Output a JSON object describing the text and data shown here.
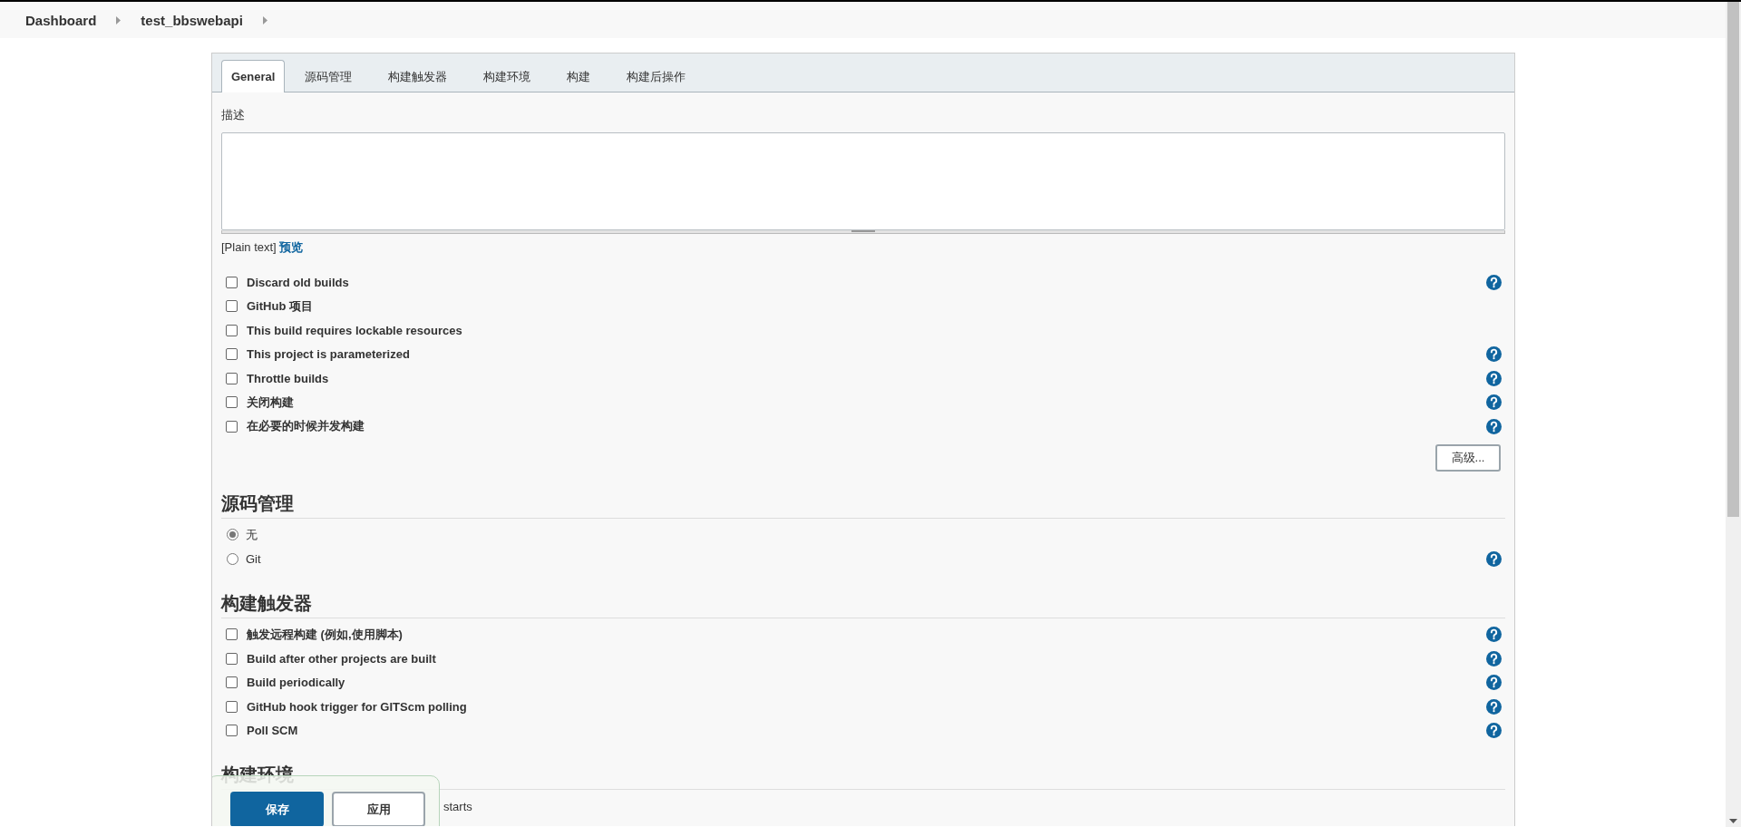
{
  "breadcrumbs": [
    "Dashboard",
    "test_bbswebapi"
  ],
  "tabs": [
    {
      "label": "General",
      "selected": true
    },
    {
      "label": "源码管理",
      "selected": false
    },
    {
      "label": "构建触发器",
      "selected": false
    },
    {
      "label": "构建环境",
      "selected": false
    },
    {
      "label": "构建",
      "selected": false
    },
    {
      "label": "构建后操作",
      "selected": false
    }
  ],
  "description": {
    "label": "描述"
  },
  "format": {
    "text": "[Plain text]",
    "link": "预览"
  },
  "general_options": [
    {
      "label": "Discard old builds",
      "checked": false,
      "help": true
    },
    {
      "label": "GitHub 项目",
      "checked": false,
      "help": false
    },
    {
      "label": "This build requires lockable resources",
      "checked": false,
      "help": false
    },
    {
      "label": "This project is parameterized",
      "checked": false,
      "help": true
    },
    {
      "label": "Throttle builds",
      "checked": false,
      "help": true
    },
    {
      "label": "关闭构建",
      "checked": false,
      "help": true
    },
    {
      "label": "在必要的时候并发构建",
      "checked": false,
      "help": true
    }
  ],
  "advanced_button": "高级...",
  "sections": [
    {
      "title": "源码管理",
      "items": [
        {
          "kind": "radio",
          "label": "无",
          "selected": true,
          "help": false
        },
        {
          "kind": "radio",
          "label": "Git",
          "selected": false,
          "help": true
        }
      ]
    },
    {
      "title": "构建触发器",
      "items": [
        {
          "kind": "checkbox",
          "label": "触发远程构建 (例如,使用脚本)",
          "checked": false,
          "help": true
        },
        {
          "kind": "checkbox",
          "label": "Build after other projects are built",
          "checked": false,
          "help": true
        },
        {
          "kind": "checkbox",
          "label": "Build periodically",
          "checked": false,
          "help": true
        },
        {
          "kind": "checkbox",
          "label": "GitHub hook trigger for GITScm polling",
          "checked": false,
          "help": true
        },
        {
          "kind": "checkbox",
          "label": "Poll SCM",
          "checked": false,
          "help": true
        }
      ]
    },
    {
      "title": "构建环境",
      "items": [
        {
          "kind": "text",
          "label": "starts",
          "help": false,
          "covered": true
        }
      ]
    }
  ],
  "actions": {
    "save": "保存",
    "apply": "应用"
  }
}
